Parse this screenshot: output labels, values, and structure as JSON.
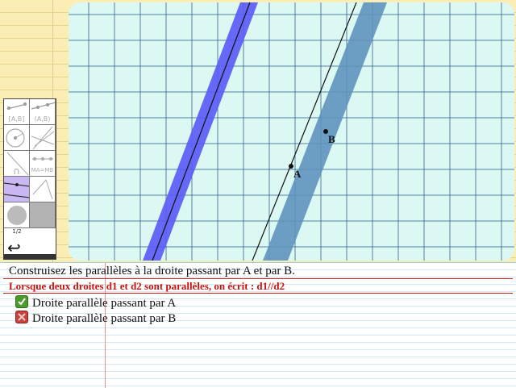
{
  "points": {
    "a": {
      "label": "A"
    },
    "b": {
      "label": "B"
    }
  },
  "palette": {
    "tools": [
      {
        "name": "segment-tool",
        "label": "[A,B]"
      },
      {
        "name": "ray-tool",
        "label": "(A,B)"
      },
      {
        "name": "circle-tool",
        "label": ""
      },
      {
        "name": "perpendicular-tool",
        "label": ""
      },
      {
        "name": "angle-tool",
        "label": "∩"
      },
      {
        "name": "midpoint-equal-tool",
        "label": "MA=MB"
      },
      {
        "name": "parallel-tool",
        "label": ""
      },
      {
        "name": "compass-tool",
        "label": ""
      },
      {
        "name": "fill-tool",
        "label": ""
      },
      {
        "name": "gray-tool",
        "label": ""
      }
    ],
    "page_indicator": "1/2",
    "back_glyph": "↩"
  },
  "instructions": {
    "main": "Construisez les parallèles à la droite passant par A et par B.",
    "definition": "Lorsque deux droites d1 et d2 sont parallèles, on écrit : d1//d2",
    "tasks": [
      {
        "label": "Droite parallèle passant par A",
        "status": "done",
        "icon": "check-icon"
      },
      {
        "label": "Droite parallèle passant par B",
        "status": "not-done",
        "icon": "cross-icon"
      }
    ]
  },
  "colors": {
    "grid_background": "#dcf8f3",
    "grid_lines": "#2a5a8a",
    "band_reference": "#5b5cf7",
    "band_b": "#6a9dc3",
    "definition_text": "#d01010",
    "check": "#4a9a2c",
    "cross": "#c9413a",
    "active_tool": "#c9b8f4"
  }
}
